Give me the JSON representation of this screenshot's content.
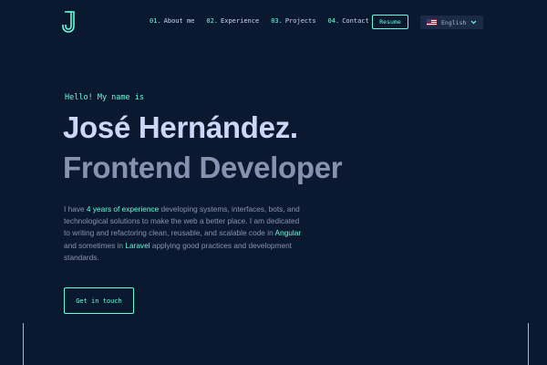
{
  "header": {
    "logo": {
      "icon": "j-logo-icon",
      "color": "#64ffda"
    },
    "nav": [
      {
        "num": "01.",
        "label": "About me"
      },
      {
        "num": "02.",
        "label": "Experience"
      },
      {
        "num": "03.",
        "label": "Projects"
      },
      {
        "num": "04.",
        "label": "Contact"
      }
    ],
    "resume_label": "Resume",
    "language": {
      "selected": "English",
      "flag_icon": "us-flag-icon",
      "chevron_icon": "chevron-down-icon"
    }
  },
  "hero": {
    "greeting": "Hello! My name is",
    "name": "José Hernández.",
    "role": "Frontend Developer",
    "intro": {
      "p1": "I have ",
      "hl1": "4 years of experience",
      "p2": " developing systems, interfaces, bots, and technological solutions to make the web a better place. I am dedicated to writing and refactoring clean, reusable, and scalable code in ",
      "hl2": "Angular",
      "p3": " and sometimes in ",
      "hl3": "Laravel",
      "p4": " applying good practices and development standards."
    },
    "cta_label": "Get in touch"
  },
  "colors": {
    "background": "#0b1930",
    "accent": "#64ffda",
    "heading": "#ccd6f6",
    "text": "#8892b0"
  }
}
